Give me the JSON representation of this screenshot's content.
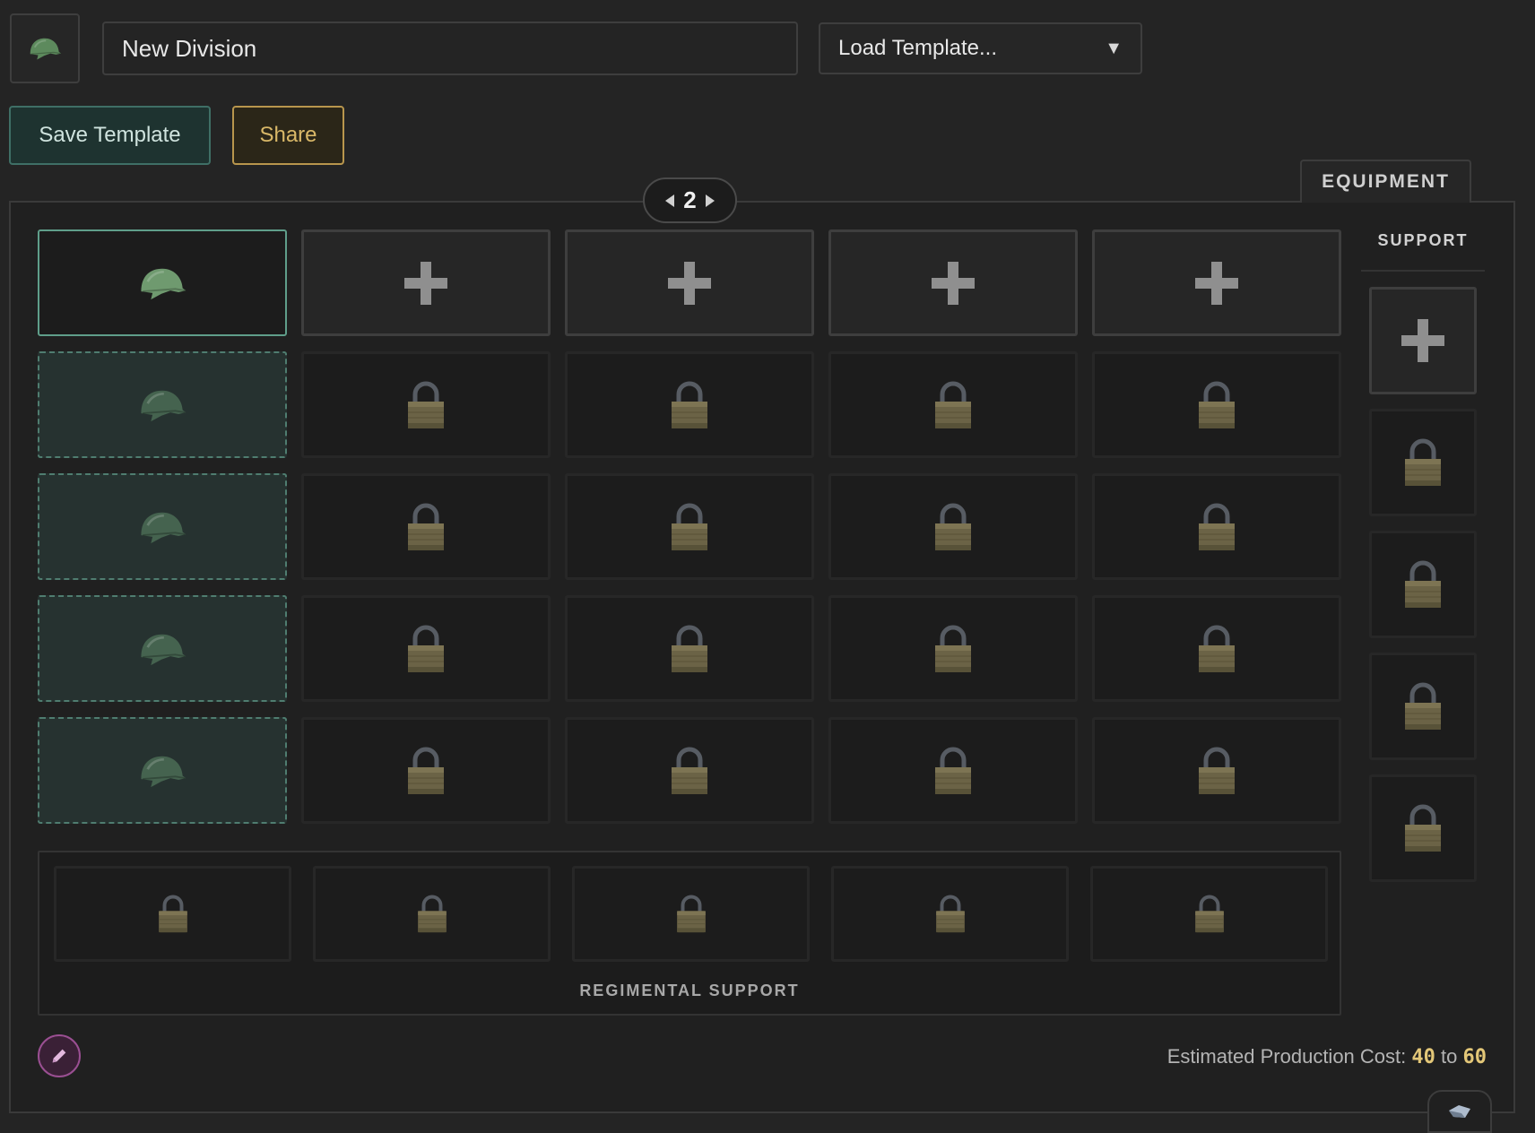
{
  "header": {
    "division_icon": "helmet-icon",
    "division_name": "New Division",
    "template_dropdown_label": "Load Template...",
    "template_dropdown_caret": "▼"
  },
  "actions": {
    "save_label": "Save Template",
    "share_label": "Share"
  },
  "tabs": {
    "equipment_label": "EQUIPMENT"
  },
  "page_nav": {
    "current_page": "2"
  },
  "grid": {
    "columns": 5,
    "rows": 5,
    "first_column": [
      "unit-filled",
      "ghost",
      "ghost",
      "ghost",
      "ghost"
    ],
    "top_row_other_columns": "add",
    "remaining_cells": "locked"
  },
  "support": {
    "header": "SUPPORT",
    "slots": [
      "add",
      "locked",
      "locked",
      "locked",
      "locked"
    ]
  },
  "regimental_support": {
    "label": "REGIMENTAL SUPPORT",
    "slots": [
      "locked",
      "locked",
      "locked",
      "locked",
      "locked"
    ]
  },
  "footer": {
    "cost_label": "Estimated Production Cost:",
    "cost_min": "40",
    "cost_separator": "to",
    "cost_max": "60",
    "edit_icon": "pencil-icon",
    "corner_icon": "eraser-icon"
  },
  "colors": {
    "background": "#242424",
    "unit_accent": "#5f9e8a",
    "share_accent": "#b8964d",
    "lock_body": "#6b6346",
    "cost_value": "#e3c778",
    "edit_accent": "#9a4f92"
  }
}
